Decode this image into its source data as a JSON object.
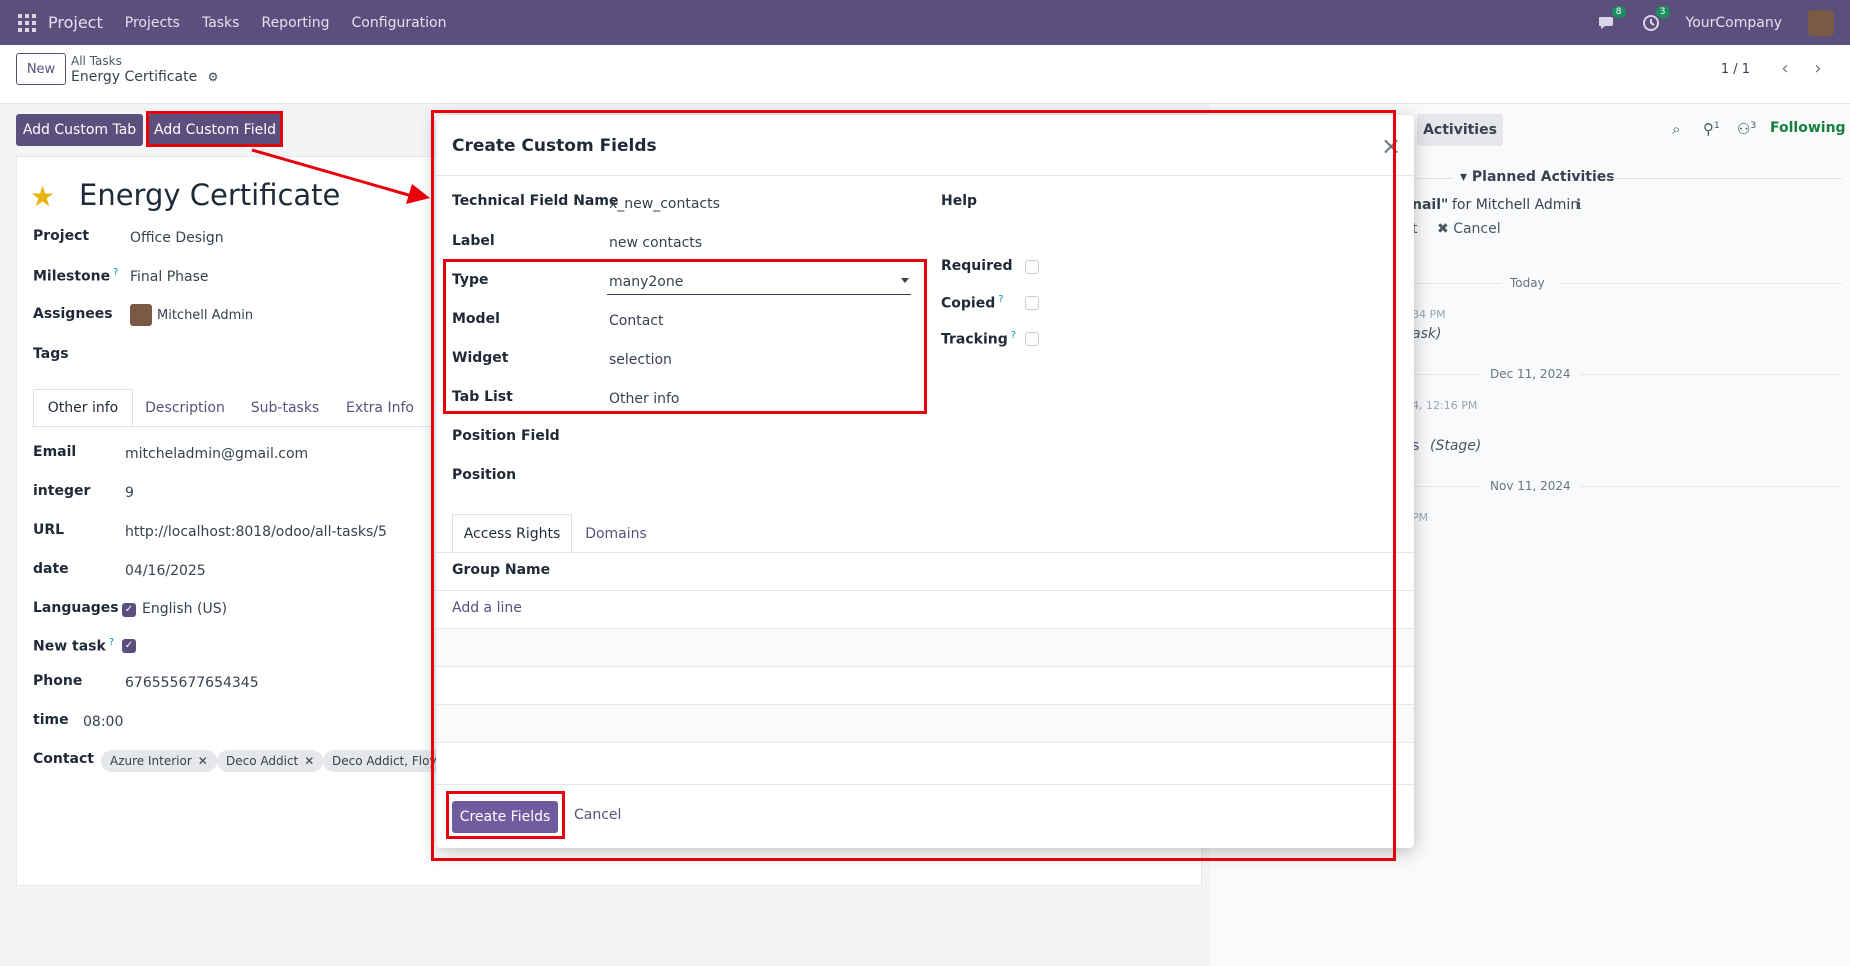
{
  "topnav": {
    "brand": "Project",
    "menu": [
      "Projects",
      "Tasks",
      "Reporting",
      "Configuration"
    ],
    "messages_badge": "8",
    "activities_badge": "3",
    "company": "YourCompany"
  },
  "control_panel": {
    "new_label": "New",
    "breadcrumb_parent": "All Tasks",
    "breadcrumb_current": "Energy Certificate",
    "pager": "1 / 1"
  },
  "buttons": {
    "add_custom_tab": "Add Custom Tab",
    "add_custom_field": "Add Custom Field"
  },
  "record": {
    "title": "Energy Certificate",
    "fields": {
      "project_label": "Project",
      "project_value": "Office Design",
      "milestone_label": "Milestone",
      "milestone_value": "Final Phase",
      "assignees_label": "Assignees",
      "assignees_value": "Mitchell Admin",
      "tags_label": "Tags"
    },
    "tabs": [
      "Other info",
      "Description",
      "Sub-tasks",
      "Extra Info"
    ],
    "other_info": {
      "email_label": "Email",
      "email_value": "mitcheladmin@gmail.com",
      "integer_label": "integer",
      "integer_value": "9",
      "url_label": "URL",
      "url_value": "http://localhost:8018/odoo/all-tasks/5",
      "date_label": "date",
      "date_value": "04/16/2025",
      "languages_label": "Languages",
      "languages_value": "English (US)",
      "newtask_label": "New task",
      "phone_label": "Phone",
      "phone_value": "676555677654345",
      "time_label": "time",
      "time_value": "08:00",
      "contact_label": "Contact",
      "contact_tags": [
        "Azure Interior",
        "Deco Addict",
        "Deco Addict, Floy"
      ]
    }
  },
  "chatter": {
    "activities_button": "Activities",
    "attach_count": "1",
    "followers_count": "3",
    "following": "Following",
    "planned_activities": "Planned Activities",
    "activity_fragment": "nail\"",
    "activity_for": "for Mitchell Admin",
    "mark_done_fragment": "t",
    "cancel": "Cancel",
    "today": "Today",
    "time_fragment_1": "34 PM",
    "task_fragment": "ask)",
    "date_dec": "Dec 11, 2024",
    "time_fragment_2": "4, 12:16 PM",
    "stage_prefix": "s",
    "stage": "(Stage)",
    "date_nov": "Nov 11, 2024",
    "time_fragment_3": "PM"
  },
  "modal": {
    "title": "Create Custom Fields",
    "technical_name_label": "Technical Field Name",
    "technical_name_value": "x_new_contacts",
    "label_label": "Label",
    "label_value": "new contacts",
    "type_label": "Type",
    "type_value": "many2one",
    "model_label": "Model",
    "model_value": "Contact",
    "widget_label": "Widget",
    "widget_value": "selection",
    "tab_list_label": "Tab List",
    "tab_list_value": "Other info",
    "position_field_label": "Position Field",
    "position_label": "Position",
    "help_label": "Help",
    "required_label": "Required",
    "copied_label": "Copied",
    "tracking_label": "Tracking",
    "tabs": [
      "Access Rights",
      "Domains"
    ],
    "group_name_header": "Group Name",
    "add_line": "Add a line",
    "create_button": "Create Fields",
    "cancel_button": "Cancel"
  },
  "colors": {
    "nav": "#5b4f7e",
    "primary": "#5b4f7e",
    "annotation": "#e8000b",
    "following": "#15803d"
  }
}
